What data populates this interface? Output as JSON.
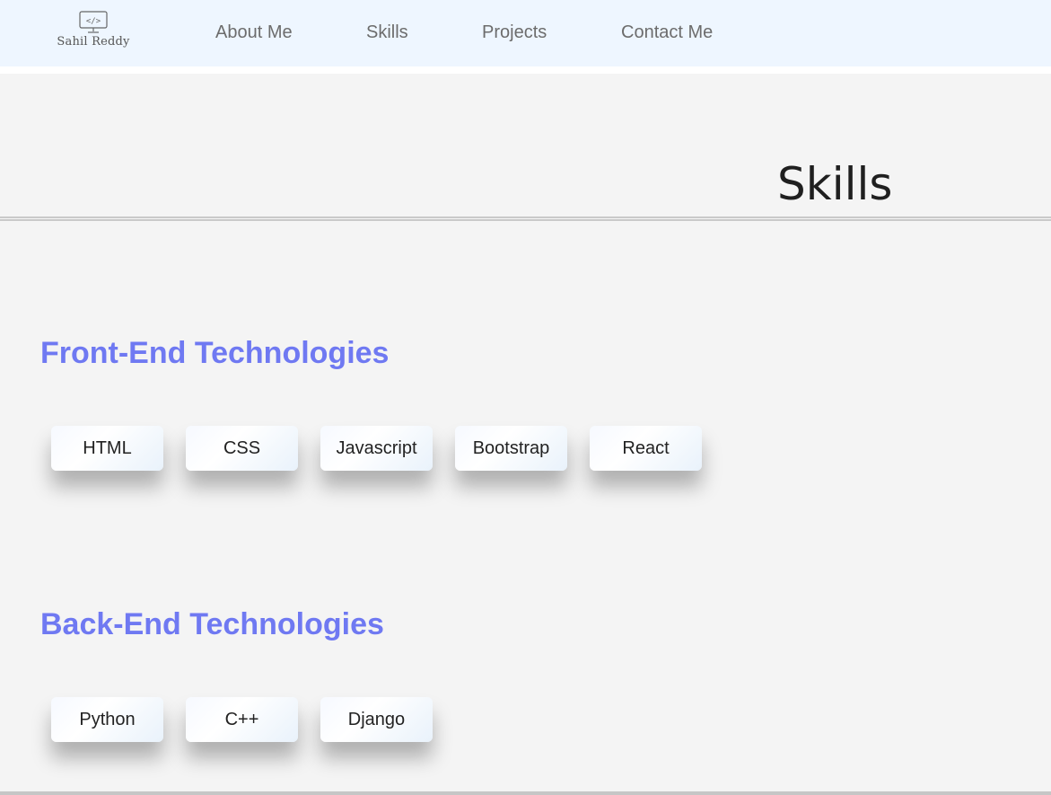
{
  "brand": {
    "name": "Sahil Reddy",
    "logo_icon": "code-monitor-icon"
  },
  "nav": {
    "about": "About Me",
    "skills": "Skills",
    "projects": "Projects",
    "contact": "Contact Me"
  },
  "section_title": "Skills",
  "frontend": {
    "heading": "Front-End Technologies",
    "items": [
      "HTML",
      "CSS",
      "Javascript",
      "Bootstrap",
      "React"
    ]
  },
  "backend": {
    "heading": "Back-End Technologies",
    "items": [
      "Python",
      "C++",
      "Django"
    ]
  },
  "colors": {
    "navbar_bg": "#eef6ff",
    "page_bg": "#f4f4f4",
    "heading_accent": "#6f79f2"
  }
}
